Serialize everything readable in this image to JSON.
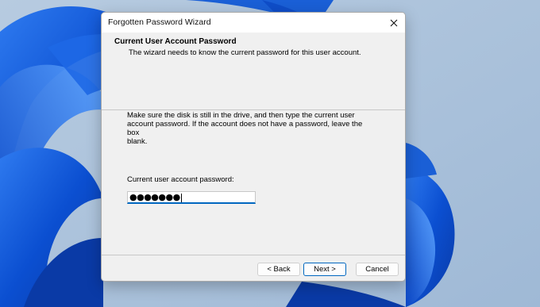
{
  "window": {
    "title": "Forgotten Password Wizard"
  },
  "header": {
    "title": "Current User Account Password",
    "subtitle": "The wizard needs to know the current password for this user account."
  },
  "body": {
    "instructions_line1": "Make sure the disk is still in the drive, and then type the current user",
    "instructions_line2": "account password. If the account does not have a password, leave the box",
    "instructions_line3": "blank.",
    "password_label": "Current user account password:",
    "password_value": "●●●●●●●"
  },
  "buttons": {
    "back": "< Back",
    "next": "Next >",
    "cancel": "Cancel"
  },
  "icons": {
    "close": "close-icon"
  },
  "colors": {
    "accent": "#0067c0",
    "dialog_bg": "#f0f0f0",
    "wallpaper_blue": "#1a5fd6"
  }
}
